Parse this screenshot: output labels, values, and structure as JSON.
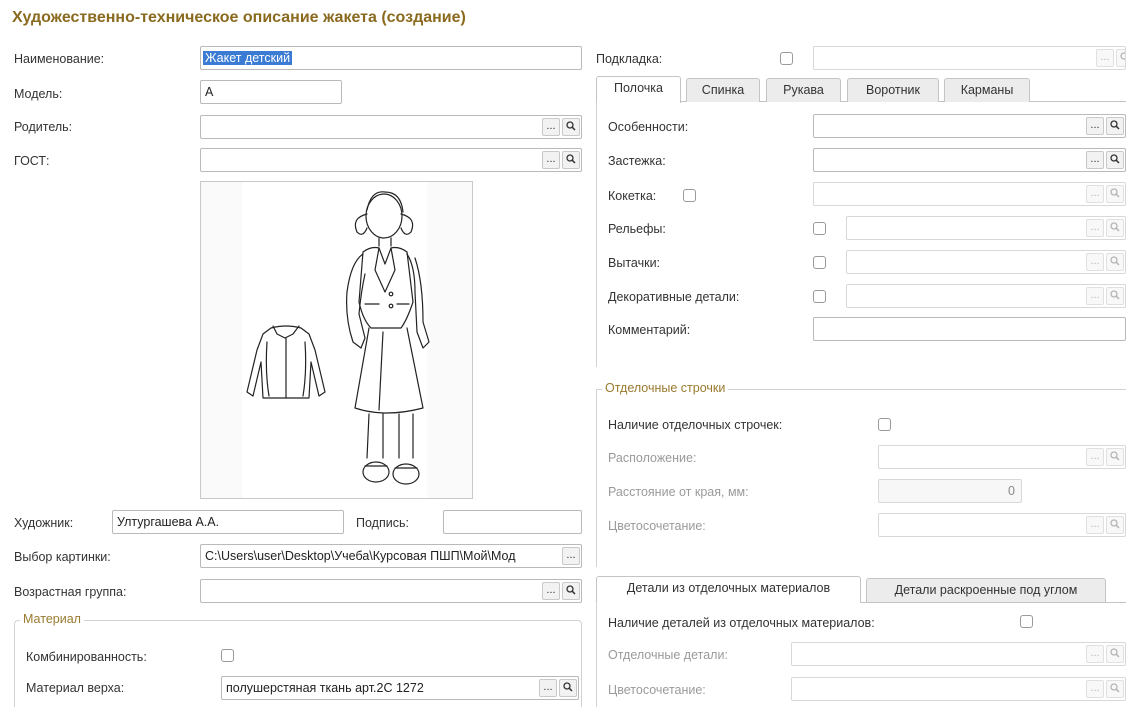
{
  "title": "Художественно-техническое описание жакета (создание)",
  "left": {
    "name_label": "Наименование:",
    "name_value": "Жакет детский",
    "model_label": "Модель:",
    "model_value": "А",
    "parent_label": "Родитель:",
    "parent_value": "",
    "gost_label": "ГОСТ:",
    "gost_value": "",
    "artist_label": "Художник:",
    "artist_value": "Ултургашева А.А.",
    "signature_label": "Подпись:",
    "signature_value": "",
    "picture_label": "Выбор картинки:",
    "picture_value": "C:\\Users\\user\\Desktop\\Учеба\\Курсовая ПШП\\Мой\\Мод",
    "age_label": "Возрастная группа:",
    "age_value": "",
    "material_group": "Материал",
    "combined_label": "Комбинированность:",
    "combined_checked": false,
    "top_material_label": "Материал верха:",
    "top_material_value": "полушерстяная ткань арт.2С 1272"
  },
  "right": {
    "lining_label": "Подкладка:",
    "lining_checked": false,
    "lining_value": "",
    "tabs": [
      "Полочка",
      "Спинка",
      "Рукава",
      "Воротник",
      "Карманы"
    ],
    "active_tab": "Полочка",
    "features_label": "Особенности:",
    "fastener_label": "Застежка:",
    "yoke_label": "Кокетка:",
    "reliefs_label": "Рельефы:",
    "darts_label": "Вытачки:",
    "decor_label": "Декоративные детали:",
    "comment_label": "Комментарий:",
    "finishing_group": "Отделочные строчки",
    "finishing_present_label": "Наличие отделочных строчек:",
    "location_label": "Расположение:",
    "distance_label": "Расстояние от края, мм:",
    "distance_value": "0",
    "color_label": "Цветосочетание:",
    "tabs2": [
      "Детали из отделочных материалов",
      "Детали раскроенные под углом"
    ],
    "active_tab2": "Детали из отделочных материалов",
    "details_present_label": "Наличие деталей из отделочных материалов:",
    "details_label": "Отделочные детали:",
    "details_color_label": "Цветосочетание:"
  },
  "icons": {
    "choose": "ellipsis-icon",
    "open": "magnifier-icon",
    "checkbox": "checkbox-icon"
  },
  "colors": {
    "title": "#8a6a1e",
    "group_title": "#9a7a2e",
    "selection": "#3b7bd4"
  }
}
